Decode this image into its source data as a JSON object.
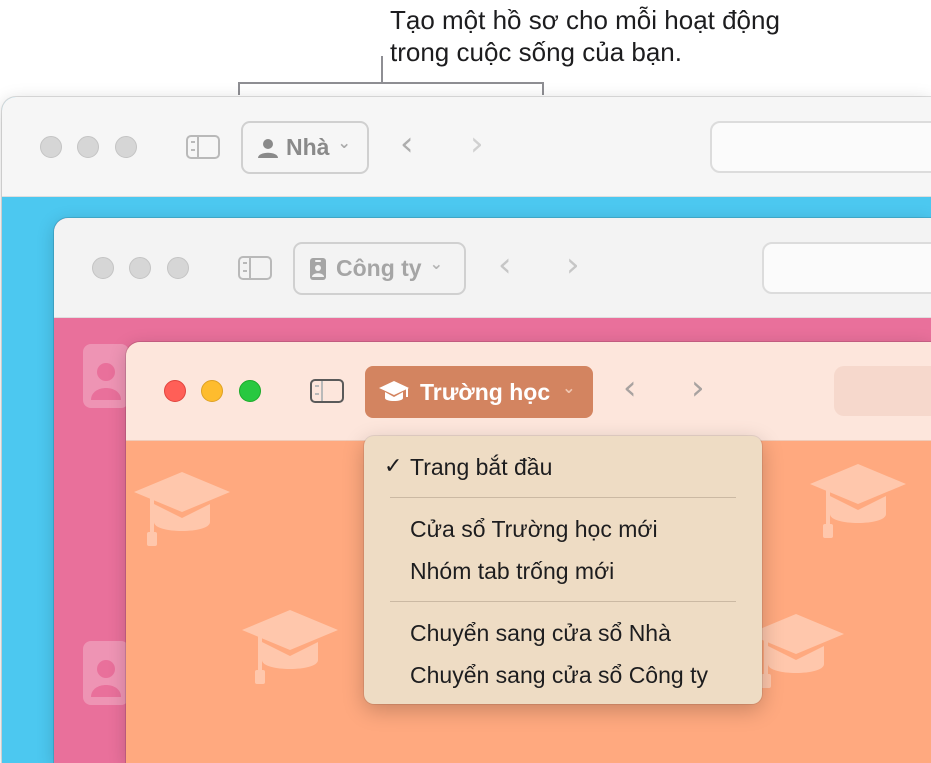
{
  "callout": {
    "line1": "Tạo một hồ sơ cho mỗi hoạt động",
    "line2": "trong cuộc sống của bạn."
  },
  "windows": {
    "home": {
      "profile_label": "Nhà",
      "profile_icon": "person-icon",
      "accent": "#4cc8f0"
    },
    "work": {
      "profile_label": "Công ty",
      "profile_icon": "id-badge-icon",
      "accent": "#e9709b"
    },
    "school": {
      "profile_label": "Trường học",
      "profile_icon": "graduation-cap-icon",
      "accent": "#ffa97f",
      "button_color": "#d38460"
    }
  },
  "menu": {
    "checked_item": "Trang bắt đầu",
    "items_group2": [
      "Cửa sổ Trường học mới",
      "Nhóm tab trống mới"
    ],
    "items_group3": [
      "Chuyển sang cửa sổ Nhà",
      "Chuyển sang cửa sổ Công ty"
    ]
  },
  "icons": {
    "back": "‹",
    "forward": "›",
    "dropdown": "⌄",
    "check": "✓"
  }
}
